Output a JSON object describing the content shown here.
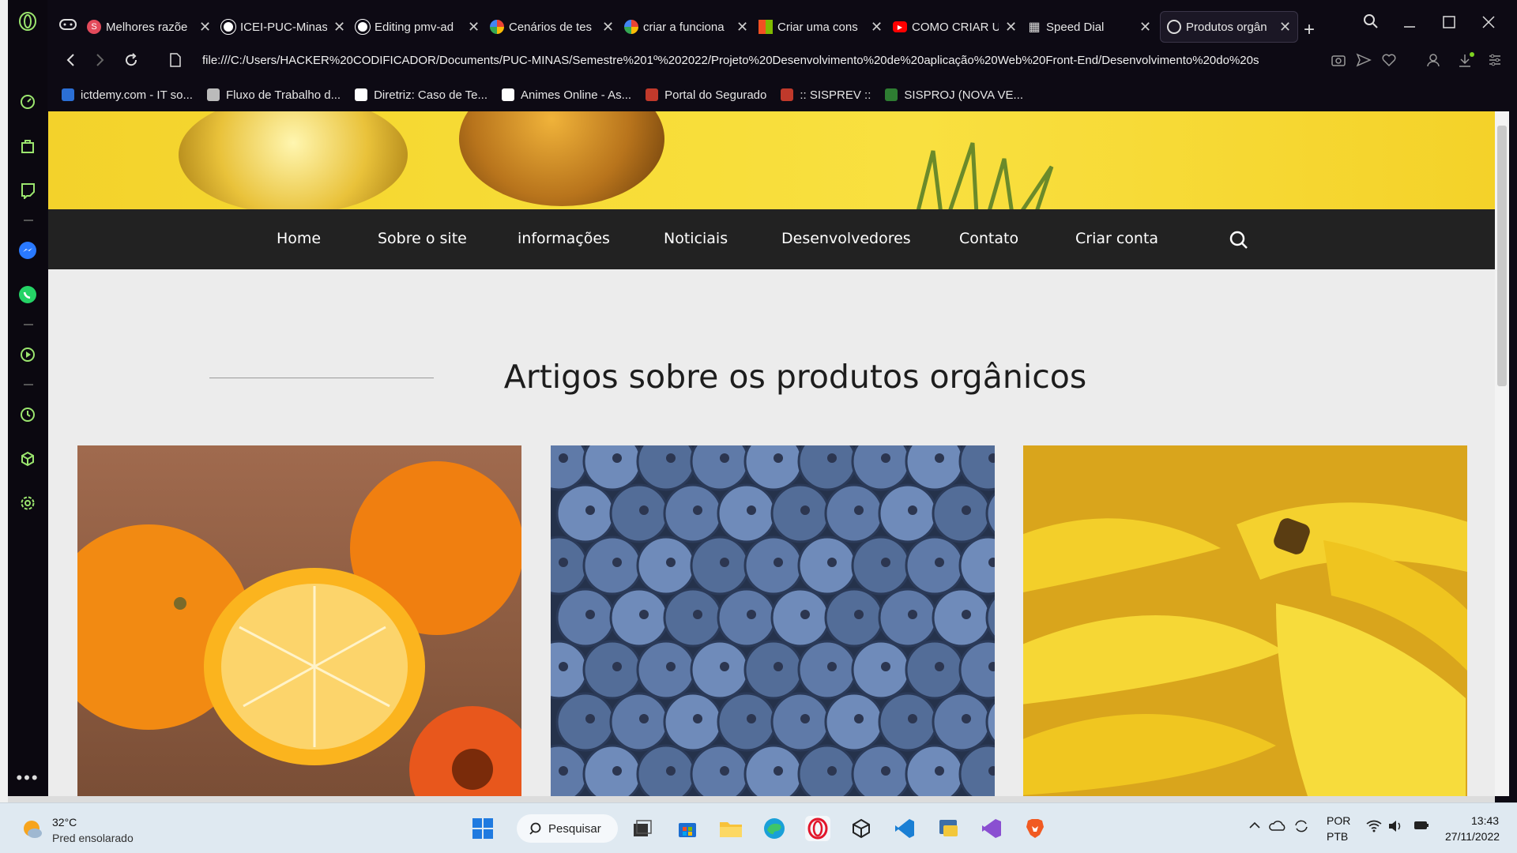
{
  "browser": {
    "tabs": [
      {
        "label": "Melhores razõe",
        "favicon_color": "#e34a5b",
        "favicon_glyph": "S"
      },
      {
        "label": "ICEI-PUC-Minas",
        "favicon_color": "#ffffff",
        "favicon_glyph": "github"
      },
      {
        "label": "Editing pmv-ad",
        "favicon_color": "#ffffff",
        "favicon_glyph": "github"
      },
      {
        "label": "Cenários de tes",
        "favicon_color": "#ffffff",
        "favicon_glyph": "google"
      },
      {
        "label": "criar a funciona",
        "favicon_color": "#ffffff",
        "favicon_glyph": "google"
      },
      {
        "label": "Criar uma cons",
        "favicon_color": "#f25022",
        "favicon_glyph": "microsoft"
      },
      {
        "label": "COMO CRIAR U",
        "favicon_color": "#ff0000",
        "favicon_glyph": "youtube"
      },
      {
        "label": "Speed Dial",
        "favicon_color": "#ffffff",
        "favicon_glyph": "grid"
      },
      {
        "label": "Produtos orgân",
        "favicon_color": "#ffffff",
        "favicon_glyph": "globe",
        "active": true
      }
    ],
    "url": "file:///C:/Users/HACKER%20CODIFICADOR/Documents/PUC-MINAS/Semestre%201º%202022/Projeto%20Desenvolvimento%20de%20aplicação%20Web%20Front-End/Desenvolvimento%20do%20s",
    "bookmarks": [
      {
        "label": "ictdemy.com - IT so...",
        "icon_color": "#2b6fd6"
      },
      {
        "label": "Fluxo de Trabalho d...",
        "icon_color": "#bbbbbb"
      },
      {
        "label": "Diretriz: Caso de Te...",
        "icon_color": "#ffffff"
      },
      {
        "label": "Animes Online - As...",
        "icon_color": "#ffffff"
      },
      {
        "label": "Portal do Segurado",
        "icon_color": "#c0392b"
      },
      {
        "label": ":: SISPREV ::",
        "icon_color": "#c0392b"
      },
      {
        "label": "SISPROJ (NOVA VE...",
        "icon_color": "#2e7d32"
      }
    ],
    "sidebar_icons": [
      "speed-dial-icon",
      "bag-icon",
      "twitch-icon",
      "messenger-icon",
      "whatsapp-icon",
      "player-icon",
      "history-icon",
      "cube-icon",
      "settings-icon",
      "more-icon"
    ]
  },
  "site": {
    "nav": [
      "Home",
      "Sobre o site",
      "informações",
      "Noticiais",
      "Desenvolvedores",
      "Contato",
      "Criar conta"
    ],
    "section_title": "Artigos sobre os produtos orgânicos"
  },
  "taskbar": {
    "weather_temp": "32°C",
    "weather_desc": "Pred ensolarado",
    "search_label": "Pesquisar",
    "lang_top": "POR",
    "lang_bottom": "PTB",
    "time": "13:43",
    "date": "27/11/2022"
  }
}
